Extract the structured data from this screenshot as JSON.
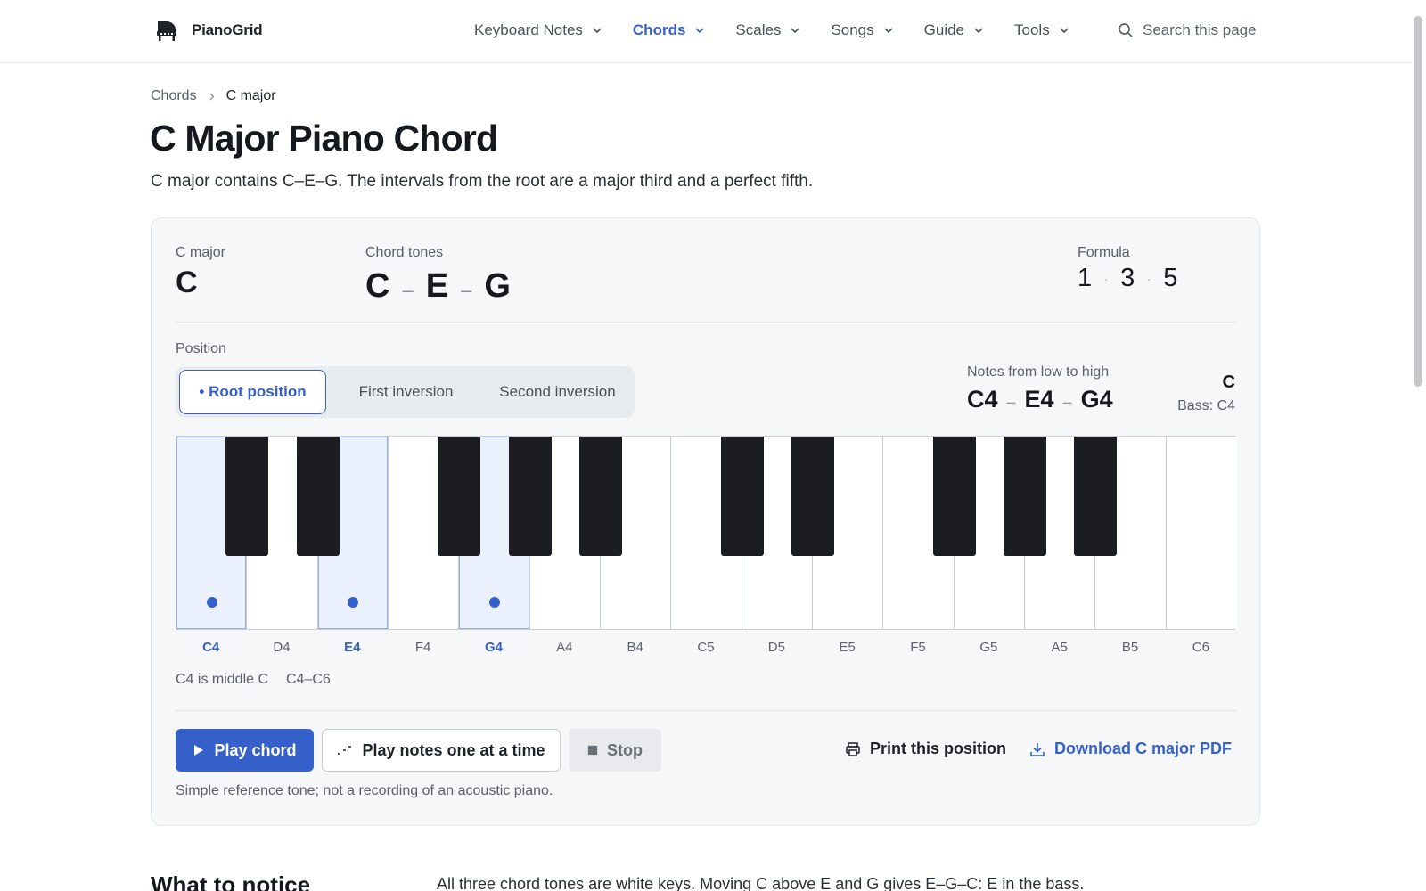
{
  "header": {
    "brand": "PianoGrid",
    "nav": [
      {
        "label": "Keyboard Notes",
        "active": false
      },
      {
        "label": "Chords",
        "active": true
      },
      {
        "label": "Scales",
        "active": false
      },
      {
        "label": "Songs",
        "active": false
      },
      {
        "label": "Guide",
        "active": false
      },
      {
        "label": "Tools",
        "active": false
      }
    ],
    "search_placeholder": "Search this page"
  },
  "breadcrumb": {
    "parent": "Chords",
    "current": "C major"
  },
  "page": {
    "title": "C Major Piano Chord",
    "intro": "C major contains C–E–G. The intervals from the root are a major third and a perfect fifth."
  },
  "chord": {
    "name_label": "C major",
    "symbol": "C",
    "tones_label": "Chord tones",
    "tones": [
      "C",
      "E",
      "G"
    ],
    "tones_separator": "–",
    "formula_label": "Formula",
    "formula": [
      "1",
      "3",
      "5"
    ],
    "formula_separator": "·"
  },
  "position": {
    "label": "Position",
    "options": [
      {
        "label": "• Root position",
        "active": true
      },
      {
        "label": "First inversion",
        "active": false
      },
      {
        "label": "Second inversion",
        "active": false
      }
    ],
    "notes_label": "Notes from low to high",
    "notes": [
      "C4",
      "E4",
      "G4"
    ],
    "chord_symbol": "C",
    "bass": "Bass: C4"
  },
  "keyboard": {
    "white_keys": [
      {
        "note": "C4",
        "highlighted": true
      },
      {
        "note": "D4",
        "highlighted": false
      },
      {
        "note": "E4",
        "highlighted": true
      },
      {
        "note": "F4",
        "highlighted": false
      },
      {
        "note": "G4",
        "highlighted": true
      },
      {
        "note": "A4",
        "highlighted": false
      },
      {
        "note": "B4",
        "highlighted": false
      },
      {
        "note": "C5",
        "highlighted": false
      },
      {
        "note": "D5",
        "highlighted": false
      },
      {
        "note": "E5",
        "highlighted": false
      },
      {
        "note": "F5",
        "highlighted": false
      },
      {
        "note": "G5",
        "highlighted": false
      },
      {
        "note": "A5",
        "highlighted": false
      },
      {
        "note": "B5",
        "highlighted": false
      },
      {
        "note": "C6",
        "highlighted": false
      }
    ],
    "black_key_after_white": [
      0,
      1,
      3,
      4,
      5,
      7,
      8,
      10,
      11,
      12
    ],
    "note_middle_c": "C4 is middle C",
    "note_range": "C4–C6"
  },
  "actions": {
    "play_chord": "Play chord",
    "play_notes": "Play notes one at a time",
    "stop": "Stop",
    "print": "Print this position",
    "download": "Download C major PDF",
    "tone_note": "Simple reference tone; not a recording of an acoustic piano."
  },
  "notice": {
    "title": "What to notice",
    "body": "All three chord tones are white keys. Moving C above E and G gives E–G–C: E in the bass."
  },
  "colors": {
    "accent": "#3560c9",
    "highlight_key": "#eaf1fc",
    "black_key": "#1c1d20",
    "card_bg": "#f5f7f9"
  }
}
